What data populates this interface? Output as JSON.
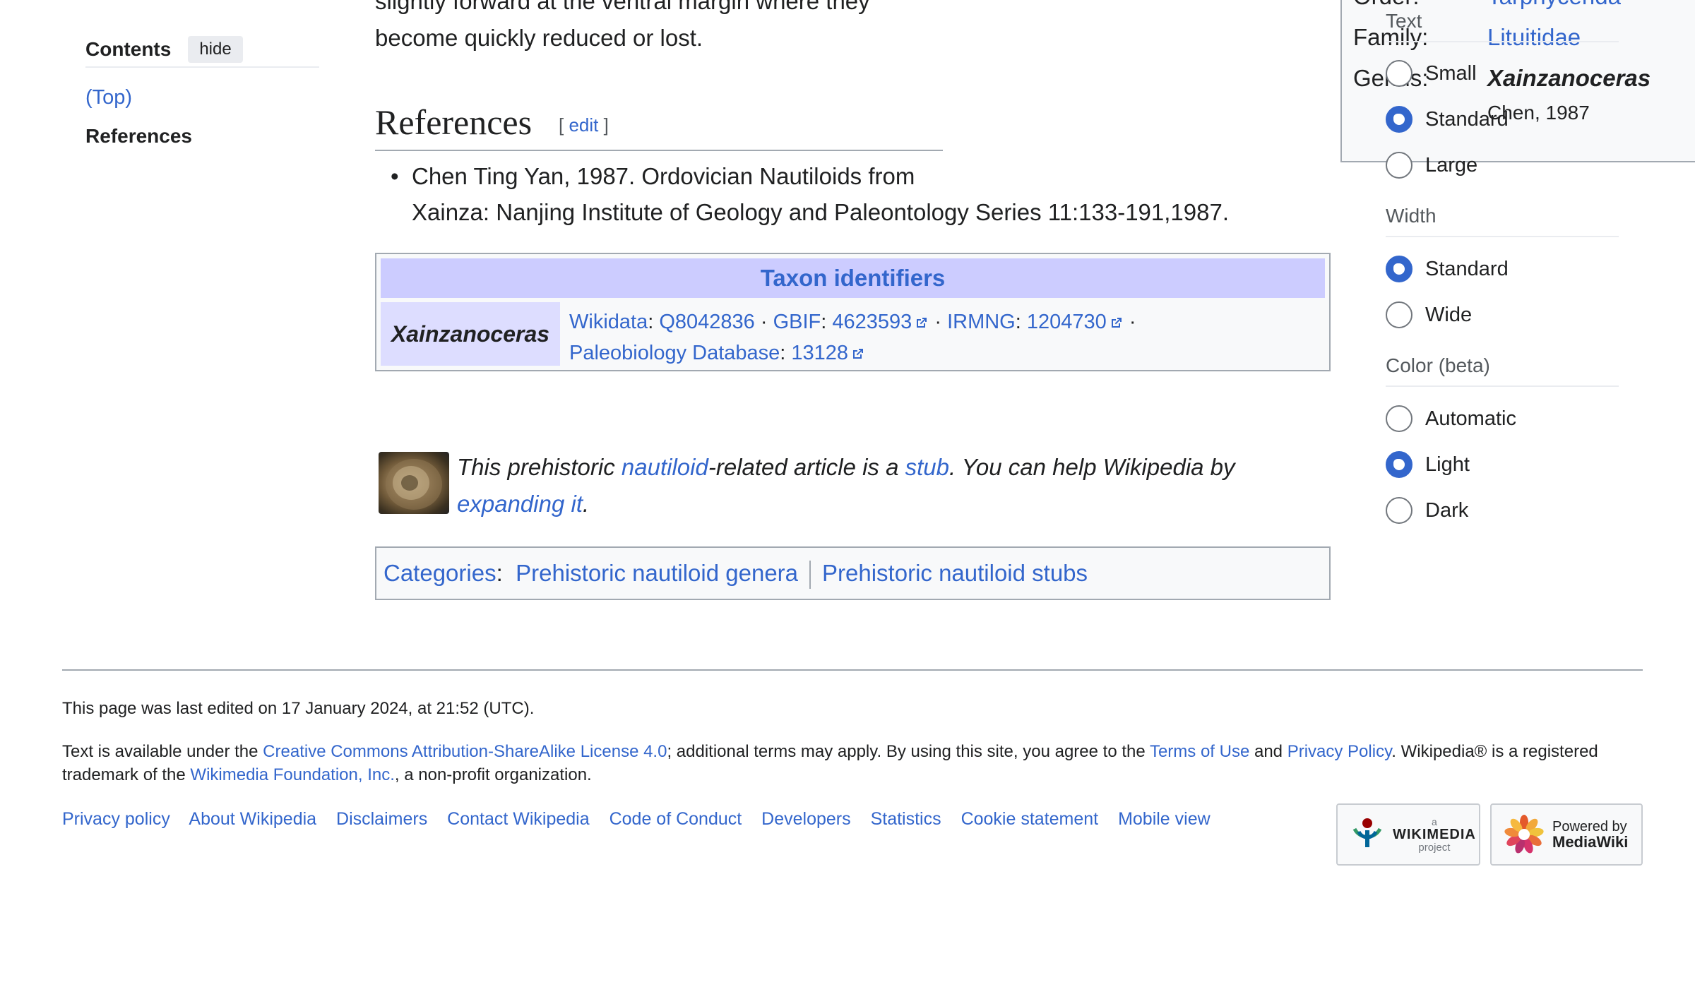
{
  "toc": {
    "title": "Contents",
    "hide_label": "hide",
    "items": [
      {
        "label": "(Top)"
      },
      {
        "label": "References"
      }
    ]
  },
  "intro": {
    "line1": "slightly forward at the ventral margin where they",
    "line2": "become quickly reduced or lost."
  },
  "infobox": {
    "rows": [
      {
        "label": "Order:",
        "value": "Tarphycerida"
      },
      {
        "label": "Family:",
        "value": "Lituitidae"
      },
      {
        "label": "Genus:",
        "value": "Xainzanoceras"
      }
    ],
    "authority": "Chen, 1987"
  },
  "references": {
    "heading": "References",
    "edit_open": "[ ",
    "edit_label": "edit",
    "edit_close": " ]",
    "items": [
      {
        "line1": "Chen Ting Yan, 1987. Ordovician Nautiloids from",
        "line2": "Xainza: Nanjing Institute of Geology and Paleontology Series 11:133-191,1987."
      }
    ]
  },
  "taxon_identifiers": {
    "title": "Taxon identifiers",
    "taxon": "Xainzanoceras",
    "entries": [
      {
        "db": "Wikidata",
        "id": "Q8042836",
        "external": false
      },
      {
        "db": "GBIF",
        "id": "4623593",
        "external": true
      },
      {
        "db": "IRMNG",
        "id": "1204730",
        "external": true
      },
      {
        "db": "Paleobiology Database",
        "id": "13128",
        "external": true
      }
    ],
    "separator": " · "
  },
  "stub": {
    "t1": "This prehistoric ",
    "link1": "nautiloid",
    "t2": "-related article is a ",
    "link2": "stub",
    "t3": ". You can help Wikipedia by ",
    "link3a": "expanding",
    "link3b": "it",
    "t4": "."
  },
  "categories": {
    "label": "Categories",
    "colon": ":",
    "items": [
      "Prehistoric nautiloid genera",
      "Prehistoric nautiloid stubs"
    ]
  },
  "appearance": {
    "groups": [
      {
        "title": "Text",
        "options": [
          {
            "label": "Small",
            "selected": false
          },
          {
            "label": "Standard",
            "selected": true
          },
          {
            "label": "Large",
            "selected": false
          }
        ]
      },
      {
        "title": "Width",
        "options": [
          {
            "label": "Standard",
            "selected": true
          },
          {
            "label": "Wide",
            "selected": false
          }
        ]
      },
      {
        "title": "Color (beta)",
        "options": [
          {
            "label": "Automatic",
            "selected": false
          },
          {
            "label": "Light",
            "selected": true
          },
          {
            "label": "Dark",
            "selected": false
          }
        ]
      }
    ]
  },
  "footer": {
    "last_edited": "This page was last edited on 17 January 2024, at 21:52 (UTC).",
    "license": {
      "t1": "Text is available under the ",
      "l1": "Creative Commons Attribution-ShareAlike License 4.0",
      "t2": "; additional terms may apply. By using this site, you agree to the ",
      "l2": "Terms of Use",
      "t3": " and ",
      "l3": "Privacy Policy",
      "t4": ". Wikipedia® is a registered trademark of the ",
      "l4": "Wikimedia Foundation, Inc.",
      "t5": ", a non-profit organization."
    },
    "links": [
      "Privacy policy",
      "About Wikipedia",
      "Disclaimers",
      "Contact Wikipedia",
      "Code of Conduct",
      "Developers",
      "Statistics",
      "Cookie statement",
      "Mobile view"
    ],
    "badge_wikimedia": {
      "small": "a",
      "name": "WIKIMEDIA",
      "sub": "project"
    },
    "badge_mediawiki": {
      "line1": "Powered by",
      "line2": "MediaWiki"
    }
  },
  "colors": {
    "link": "#3366cc",
    "taxon_header_bg": "#ccccff",
    "taxon_name_bg": "#ddddff",
    "radio_selected": "#3366cc"
  },
  "icons": [
    "external-link-icon",
    "nautiloid-shell-image",
    "wikimedia-logo",
    "mediawiki-flower-logo"
  ]
}
